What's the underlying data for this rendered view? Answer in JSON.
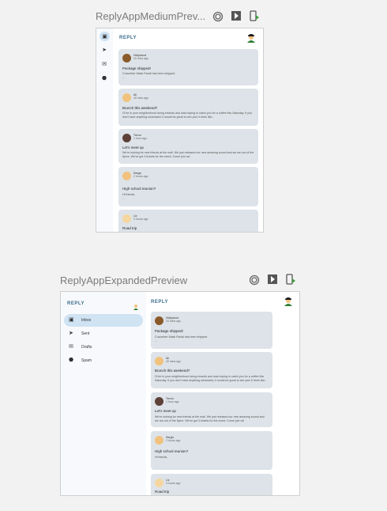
{
  "medium_preview": {
    "title": "ReplyAppMediumPrev...",
    "app_title": "REPLY",
    "emails": [
      {
        "sender": "Hollywood",
        "time": "20 mins ago",
        "subject": "Package shipped!",
        "body": "Cucumber Mask Facial has been shipped.",
        "more": "..."
      },
      {
        "sender": "Ali",
        "time": "40 mins ago",
        "subject": "Brunch this weekend?",
        "body": "I'll be in your neighborhood doing errands and was hoping to catch you for a coffee this Saturday. If you don't have anything scheduled, it would be great to see you! It feels like...",
        "more": ""
      },
      {
        "sender": "Trevor",
        "time": "1 hour ago",
        "subject": "Let's meet up",
        "body": "We're looking for new friends at the mall. We just released our new amazing sound and we ran out of the flyers. We've got 3 tickets for the event. Come join us!",
        "more": ""
      },
      {
        "sender": "Sergio",
        "time": "2 hours ago",
        "subject": "High school reunion?",
        "body": "Hi friends,",
        "more": "..."
      },
      {
        "sender": "Liz",
        "time": "3 hours ago",
        "subject": "Road trip",
        "body": "",
        "more": ""
      }
    ]
  },
  "expanded_preview": {
    "title": "ReplyAppExpandedPreview",
    "drawer_title": "REPLY",
    "app_title": "REPLY",
    "drawer_items": [
      {
        "icon": "inbox-icon",
        "label": "Inbox"
      },
      {
        "icon": "send-icon",
        "label": "Sent"
      },
      {
        "icon": "mail-icon",
        "label": "Drafts"
      },
      {
        "icon": "spam-icon",
        "label": "Spam"
      }
    ],
    "emails": [
      {
        "sender": "Hollywood",
        "time": "20 mins ago",
        "subject": "Package shipped!",
        "body": "Cucumber Mask Facial has been shipped.",
        "more": "..."
      },
      {
        "sender": "Ali",
        "time": "40 mins ago",
        "subject": "Brunch this weekend?",
        "body": "I'll be in your neighborhood doing errands and was hoping to catch you for a coffee this Saturday. If you don't have anything scheduled, it would be great to see you! It feels like...",
        "more": ""
      },
      {
        "sender": "Trevor",
        "time": "1 hour ago",
        "subject": "Let's meet up",
        "body": "We're looking for new friends at the mall. We just released our new amazing sound and we ran out of the flyers. We've got 3 tickets for the event. Come join us!",
        "more": ""
      },
      {
        "sender": "Sergio",
        "time": "2 hours ago",
        "subject": "High school reunion?",
        "body": "Hi friends,",
        "more": ""
      },
      {
        "sender": "Liz",
        "time": "3 hours ago",
        "subject": "Road trip",
        "body": "",
        "more": ""
      }
    ]
  },
  "colors": {
    "selected": "#cfe3f3",
    "card": "#dde3e8",
    "accent": "#3a6d8c"
  }
}
